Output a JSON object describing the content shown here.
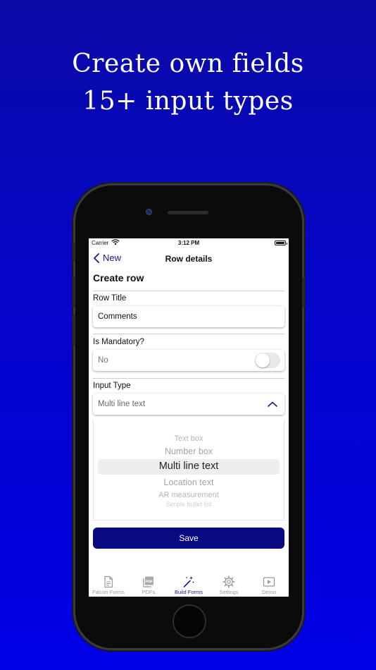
{
  "headline": {
    "line1": "Create own fields",
    "line2": "15+ input types"
  },
  "status_bar": {
    "carrier": "Carrier",
    "time": "3:12 PM"
  },
  "navbar": {
    "back_label": "New",
    "title": "Row details"
  },
  "form": {
    "section_title": "Create row",
    "row_title": {
      "label": "Row Title",
      "value": "Comments"
    },
    "mandatory": {
      "label": "Is Mandatory?",
      "value": "No",
      "toggle_on": false
    },
    "input_type": {
      "label": "Input Type",
      "value": "Multi line text"
    }
  },
  "picker": {
    "options": [
      "Text box",
      "Number box",
      "Multi line text",
      "Location text",
      "AR measurement",
      "Simple bullet list"
    ],
    "selected": "Multi line text"
  },
  "save_label": "Save",
  "tabbar": {
    "items": [
      {
        "label": "Falcon Forms",
        "icon": "document-icon"
      },
      {
        "label": "PDFs",
        "icon": "pdf-icon"
      },
      {
        "label": "Build Forms",
        "icon": "magic-wand-icon"
      },
      {
        "label": "Settings",
        "icon": "gear-icon"
      },
      {
        "label": "Demo",
        "icon": "play-icon"
      }
    ],
    "active": "Build Forms"
  },
  "colors": {
    "background_top": "#0a0aa6",
    "background_bottom": "#0000e6",
    "accent": "#1a1a8c",
    "save_button": "#0a0a80"
  }
}
